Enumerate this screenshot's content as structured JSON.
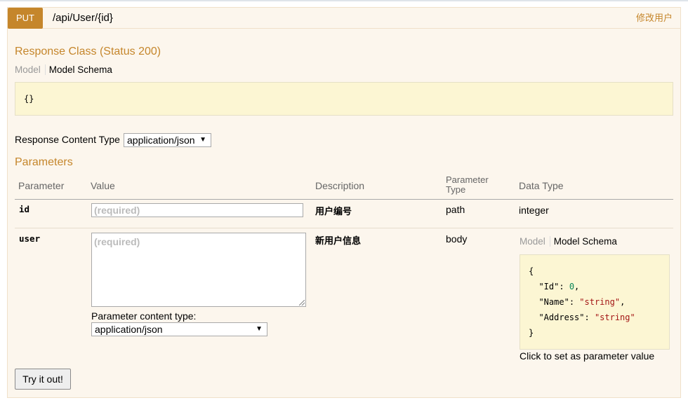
{
  "operation": {
    "method": "PUT",
    "path": "/api/User/{id}",
    "summary": "修改用户"
  },
  "response_class": {
    "heading": "Response Class (Status 200)",
    "tab_model": "Model",
    "tab_model_schema": "Model Schema",
    "body": "{}"
  },
  "response_content_type": {
    "label": "Response Content Type",
    "selected": "application/json"
  },
  "parameters": {
    "heading": "Parameters",
    "columns": {
      "parameter": "Parameter",
      "value": "Value",
      "description": "Description",
      "parameter_type_line1": "Parameter",
      "parameter_type_line2": "Type",
      "data_type": "Data Type"
    },
    "rows": [
      {
        "name": "id",
        "placeholder": "(required)",
        "description": "用户编号",
        "param_type": "path",
        "data_type": "integer"
      },
      {
        "name": "user",
        "placeholder": "(required)",
        "description": "新用户信息",
        "param_type": "body",
        "content_type_label": "Parameter content type:",
        "content_type_selected": "application/json",
        "tab_model": "Model",
        "tab_model_schema": "Model Schema",
        "schema_lines": [
          {
            "t": "{"
          },
          {
            "key": "\"Id\"",
            "val": "0",
            "kind": "n",
            "trail": ","
          },
          {
            "key": "\"Name\"",
            "val": "\"string\"",
            "kind": "s",
            "trail": ","
          },
          {
            "key": "\"Address\"",
            "val": "\"string\"",
            "kind": "s",
            "trail": ""
          },
          {
            "t": "}"
          }
        ],
        "schema_hint": "Click to set as parameter value"
      }
    ]
  },
  "try_button": "Try it out!",
  "colors": {
    "accent": "#c5862b",
    "panel_bg": "#fcf6ed",
    "code_bg": "#fcf6d3"
  }
}
